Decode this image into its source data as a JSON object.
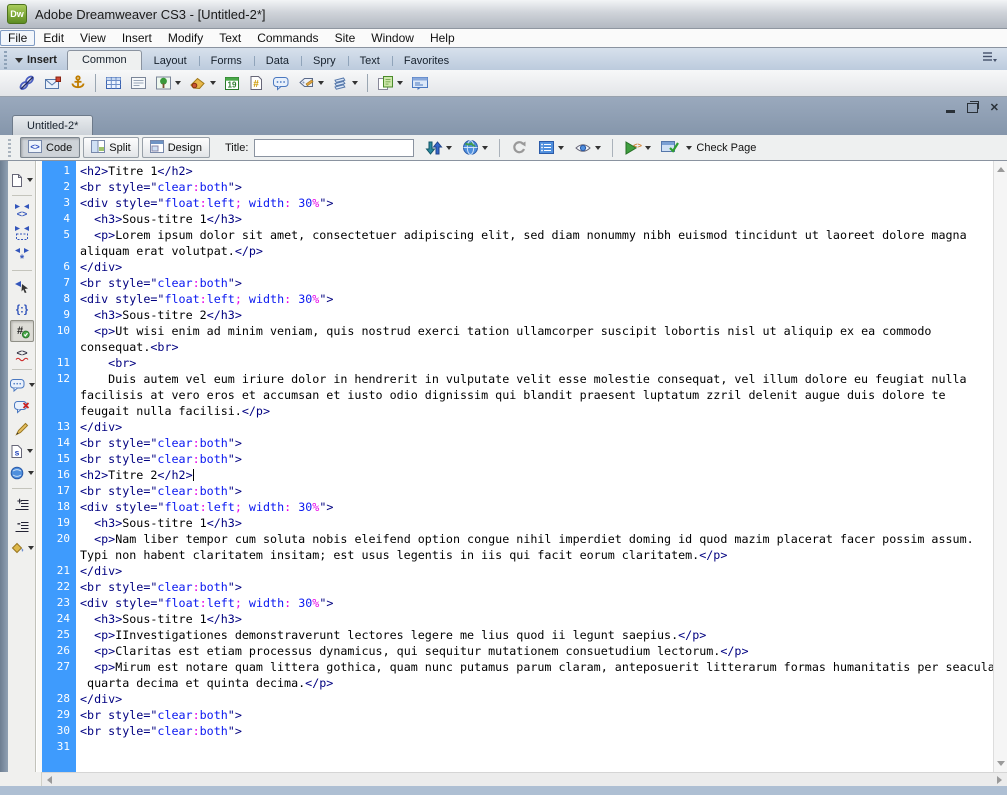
{
  "window": {
    "app_icon": "Dw",
    "title": "Adobe Dreamweaver CS3 - [Untitled-2*]",
    "controls": [
      "minimize",
      "restore",
      "close"
    ]
  },
  "menu": {
    "items": [
      "File",
      "Edit",
      "View",
      "Insert",
      "Modify",
      "Text",
      "Commands",
      "Site",
      "Window",
      "Help"
    ],
    "focused": "File"
  },
  "insert_bar": {
    "label": "Insert",
    "tabs": [
      {
        "label": "Common",
        "active": true
      },
      {
        "label": "Layout",
        "active": false
      },
      {
        "label": "Forms",
        "active": false
      },
      {
        "label": "Data",
        "active": false
      },
      {
        "label": "Spry",
        "active": false
      },
      {
        "label": "Text",
        "active": false
      },
      {
        "label": "Favorites",
        "active": false
      }
    ],
    "icons": [
      {
        "name": "hyperlink-icon"
      },
      {
        "name": "email-link-icon"
      },
      {
        "name": "named-anchor-icon"
      },
      {
        "sep": true
      },
      {
        "name": "table-icon"
      },
      {
        "name": "insert-div-icon"
      },
      {
        "name": "images-icon",
        "dropdown": true
      },
      {
        "name": "media-icon",
        "dropdown": true
      },
      {
        "name": "date-icon"
      },
      {
        "name": "server-side-include-icon"
      },
      {
        "name": "comment-icon"
      },
      {
        "name": "head-tags-icon",
        "dropdown": true
      },
      {
        "name": "script-icon",
        "dropdown": true
      },
      {
        "sep": true
      },
      {
        "name": "templates-icon",
        "dropdown": true
      },
      {
        "name": "tag-chooser-icon"
      }
    ]
  },
  "document_tab": {
    "label": "Untitled-2*"
  },
  "doc_toolbar": {
    "code_label": "Code",
    "split_label": "Split",
    "design_label": "Design",
    "title_label": "Title:",
    "title_value": "",
    "check_page_label": "Check Page",
    "icons": [
      {
        "name": "file-management-icon",
        "dropdown": true
      },
      {
        "name": "preview-browser-icon",
        "dropdown": true
      },
      {
        "sep": true
      },
      {
        "name": "refresh-icon"
      },
      {
        "name": "view-options-icon",
        "dropdown": true
      },
      {
        "name": "visual-aids-icon",
        "dropdown": true
      },
      {
        "sep": true
      },
      {
        "name": "validate-markup-icon",
        "dropdown": true
      }
    ]
  },
  "coding_toolbar": {
    "icons": [
      {
        "name": "open-documents-icon",
        "dropdown": true
      },
      {
        "sep": true
      },
      {
        "name": "collapse-full-tag-icon"
      },
      {
        "name": "collapse-selection-icon"
      },
      {
        "name": "expand-all-icon"
      },
      {
        "sep": true
      },
      {
        "name": "select-parent-tag-icon"
      },
      {
        "name": "balance-braces-icon"
      },
      {
        "name": "line-numbers-icon",
        "active": true
      },
      {
        "name": "highlight-invalid-code-icon"
      },
      {
        "sep": true
      },
      {
        "name": "apply-comment-icon",
        "dropdown": true
      },
      {
        "name": "remove-comment-icon"
      },
      {
        "name": "wrap-tag-icon"
      },
      {
        "name": "recent-snippets-icon",
        "dropdown": true
      },
      {
        "name": "move-convert-css-icon",
        "dropdown": true
      },
      {
        "sep": true
      },
      {
        "name": "indent-code-icon"
      },
      {
        "name": "outdent-code-icon"
      },
      {
        "name": "format-source-code-icon",
        "dropdown": true
      }
    ]
  },
  "code": {
    "colors": {
      "tag": "#000080",
      "value": "#0a18f0",
      "punct": "#e800e8",
      "text": "#000000",
      "gutter": "#3e9bfd"
    },
    "rows": [
      {
        "n": "1",
        "s": [
          [
            "t",
            "<h2>"
          ],
          [
            "x",
            "Titre 1"
          ],
          [
            "t",
            "</h2>"
          ]
        ]
      },
      {
        "n": "2",
        "s": [
          [
            "t",
            "<br style=\""
          ],
          [
            "v",
            "clear"
          ],
          [
            "p",
            ":"
          ],
          [
            "v",
            "both"
          ],
          [
            "t",
            "\">"
          ]
        ]
      },
      {
        "n": "3",
        "s": [
          [
            "t",
            "<div style=\""
          ],
          [
            "v",
            "float"
          ],
          [
            "p",
            ":"
          ],
          [
            "v",
            "left"
          ],
          [
            "p",
            ";"
          ],
          [
            "v",
            " width"
          ],
          [
            "p",
            ":"
          ],
          [
            "v",
            " 30"
          ],
          [
            "p",
            "%"
          ],
          [
            "t",
            "\">"
          ]
        ]
      },
      {
        "n": "4",
        "s": [
          [
            "x",
            "  "
          ],
          [
            "t",
            "<h3>"
          ],
          [
            "x",
            "Sous-titre 1"
          ],
          [
            "t",
            "</h3>"
          ]
        ]
      },
      {
        "n": "5",
        "s": [
          [
            "x",
            "  "
          ],
          [
            "t",
            "<p>"
          ],
          [
            "x",
            "Lorem ipsum dolor sit amet, consectetuer adipiscing elit, sed diam nonummy nibh euismod tincidunt ut laoreet dolore magna"
          ]
        ]
      },
      {
        "n": "",
        "s": [
          [
            "x",
            "aliquam erat volutpat."
          ],
          [
            "t",
            "</p>"
          ]
        ]
      },
      {
        "n": "6",
        "s": [
          [
            "t",
            "</div>"
          ]
        ]
      },
      {
        "n": "7",
        "s": [
          [
            "t",
            "<br style=\""
          ],
          [
            "v",
            "clear"
          ],
          [
            "p",
            ":"
          ],
          [
            "v",
            "both"
          ],
          [
            "t",
            "\">"
          ]
        ]
      },
      {
        "n": "8",
        "s": [
          [
            "t",
            "<div style=\""
          ],
          [
            "v",
            "float"
          ],
          [
            "p",
            ":"
          ],
          [
            "v",
            "left"
          ],
          [
            "p",
            ";"
          ],
          [
            "v",
            " width"
          ],
          [
            "p",
            ":"
          ],
          [
            "v",
            " 30"
          ],
          [
            "p",
            "%"
          ],
          [
            "t",
            "\">"
          ]
        ]
      },
      {
        "n": "9",
        "s": [
          [
            "x",
            "  "
          ],
          [
            "t",
            "<h3>"
          ],
          [
            "x",
            "Sous-titre 2"
          ],
          [
            "t",
            "</h3>"
          ]
        ]
      },
      {
        "n": "10",
        "s": [
          [
            "x",
            "  "
          ],
          [
            "t",
            "<p>"
          ],
          [
            "x",
            "Ut wisi enim ad minim veniam, quis nostrud exerci tation ullamcorper suscipit lobortis nisl ut aliquip ex ea commodo"
          ]
        ]
      },
      {
        "n": "",
        "s": [
          [
            "x",
            "consequat."
          ],
          [
            "t",
            "<br>"
          ]
        ]
      },
      {
        "n": "11",
        "s": [
          [
            "x",
            "    "
          ],
          [
            "t",
            "<br>"
          ]
        ]
      },
      {
        "n": "12",
        "s": [
          [
            "x",
            "    Duis autem vel eum iriure dolor in hendrerit in vulputate velit esse molestie consequat, vel illum dolore eu feugiat nulla"
          ]
        ]
      },
      {
        "n": "",
        "s": [
          [
            "x",
            "facilisis at vero eros et accumsan et iusto odio dignissim qui blandit praesent luptatum zzril delenit augue duis dolore te"
          ]
        ]
      },
      {
        "n": "",
        "s": [
          [
            "x",
            "feugait nulla facilisi."
          ],
          [
            "t",
            "</p>"
          ]
        ]
      },
      {
        "n": "13",
        "s": [
          [
            "t",
            "</div>"
          ]
        ]
      },
      {
        "n": "14",
        "s": [
          [
            "t",
            "<br style=\""
          ],
          [
            "v",
            "clear"
          ],
          [
            "p",
            ":"
          ],
          [
            "v",
            "both"
          ],
          [
            "t",
            "\">"
          ]
        ]
      },
      {
        "n": "15",
        "s": [
          [
            "t",
            "<br style=\""
          ],
          [
            "v",
            "clear"
          ],
          [
            "p",
            ":"
          ],
          [
            "v",
            "both"
          ],
          [
            "t",
            "\">"
          ]
        ]
      },
      {
        "n": "16",
        "caret": true,
        "s": [
          [
            "t",
            "<h2>"
          ],
          [
            "x",
            "Titre 2"
          ],
          [
            "t",
            "</h2>"
          ]
        ]
      },
      {
        "n": "17",
        "s": [
          [
            "t",
            "<br style=\""
          ],
          [
            "v",
            "clear"
          ],
          [
            "p",
            ":"
          ],
          [
            "v",
            "both"
          ],
          [
            "t",
            "\">"
          ]
        ]
      },
      {
        "n": "18",
        "s": [
          [
            "t",
            "<div style=\""
          ],
          [
            "v",
            "float"
          ],
          [
            "p",
            ":"
          ],
          [
            "v",
            "left"
          ],
          [
            "p",
            ";"
          ],
          [
            "v",
            " width"
          ],
          [
            "p",
            ":"
          ],
          [
            "v",
            " 30"
          ],
          [
            "p",
            "%"
          ],
          [
            "t",
            "\">"
          ]
        ]
      },
      {
        "n": "19",
        "s": [
          [
            "x",
            "  "
          ],
          [
            "t",
            "<h3>"
          ],
          [
            "x",
            "Sous-titre 1"
          ],
          [
            "t",
            "</h3>"
          ]
        ]
      },
      {
        "n": "20",
        "s": [
          [
            "x",
            "  "
          ],
          [
            "t",
            "<p>"
          ],
          [
            "x",
            "Nam liber tempor cum soluta nobis eleifend option congue nihil imperdiet doming id quod mazim placerat facer possim assum."
          ]
        ]
      },
      {
        "n": "",
        "s": [
          [
            "x",
            "Typi non habent claritatem insitam; est usus legentis in iis qui facit eorum claritatem."
          ],
          [
            "t",
            "</p>"
          ]
        ]
      },
      {
        "n": "21",
        "s": [
          [
            "t",
            "</div>"
          ]
        ]
      },
      {
        "n": "22",
        "s": [
          [
            "t",
            "<br style=\""
          ],
          [
            "v",
            "clear"
          ],
          [
            "p",
            ":"
          ],
          [
            "v",
            "both"
          ],
          [
            "t",
            "\">"
          ]
        ]
      },
      {
        "n": "23",
        "s": [
          [
            "t",
            "<div style=\""
          ],
          [
            "v",
            "float"
          ],
          [
            "p",
            ":"
          ],
          [
            "v",
            "left"
          ],
          [
            "p",
            ";"
          ],
          [
            "v",
            " width"
          ],
          [
            "p",
            ":"
          ],
          [
            "v",
            " 30"
          ],
          [
            "p",
            "%"
          ],
          [
            "t",
            "\">"
          ]
        ]
      },
      {
        "n": "24",
        "s": [
          [
            "x",
            "  "
          ],
          [
            "t",
            "<h3>"
          ],
          [
            "x",
            "Sous-titre 1"
          ],
          [
            "t",
            "</h3>"
          ]
        ]
      },
      {
        "n": "25",
        "s": [
          [
            "x",
            "  "
          ],
          [
            "t",
            "<p>"
          ],
          [
            "x",
            "IInvestigationes demonstraverunt lectores legere me lius quod ii legunt saepius."
          ],
          [
            "t",
            "</p>"
          ]
        ]
      },
      {
        "n": "26",
        "s": [
          [
            "x",
            "  "
          ],
          [
            "t",
            "<p>"
          ],
          [
            "x",
            "Claritas est etiam processus dynamicus, qui sequitur mutationem consuetudium lectorum."
          ],
          [
            "t",
            "</p>"
          ]
        ]
      },
      {
        "n": "27",
        "s": [
          [
            "x",
            "  "
          ],
          [
            "t",
            "<p>"
          ],
          [
            "x",
            "Mirum est notare quam littera gothica, quam nunc putamus parum claram, anteposuerit litterarum formas humanitatis per seacula"
          ]
        ]
      },
      {
        "n": "",
        "s": [
          [
            "x",
            " quarta decima et quinta decima."
          ],
          [
            "t",
            "</p>"
          ]
        ]
      },
      {
        "n": "28",
        "s": [
          [
            "t",
            "</div>"
          ]
        ]
      },
      {
        "n": "29",
        "s": [
          [
            "t",
            "<br style=\""
          ],
          [
            "v",
            "clear"
          ],
          [
            "p",
            ":"
          ],
          [
            "v",
            "both"
          ],
          [
            "t",
            "\">"
          ]
        ]
      },
      {
        "n": "30",
        "s": [
          [
            "t",
            "<br style=\""
          ],
          [
            "v",
            "clear"
          ],
          [
            "p",
            ":"
          ],
          [
            "v",
            "both"
          ],
          [
            "t",
            "\">"
          ]
        ]
      },
      {
        "n": "31",
        "s": []
      }
    ]
  }
}
